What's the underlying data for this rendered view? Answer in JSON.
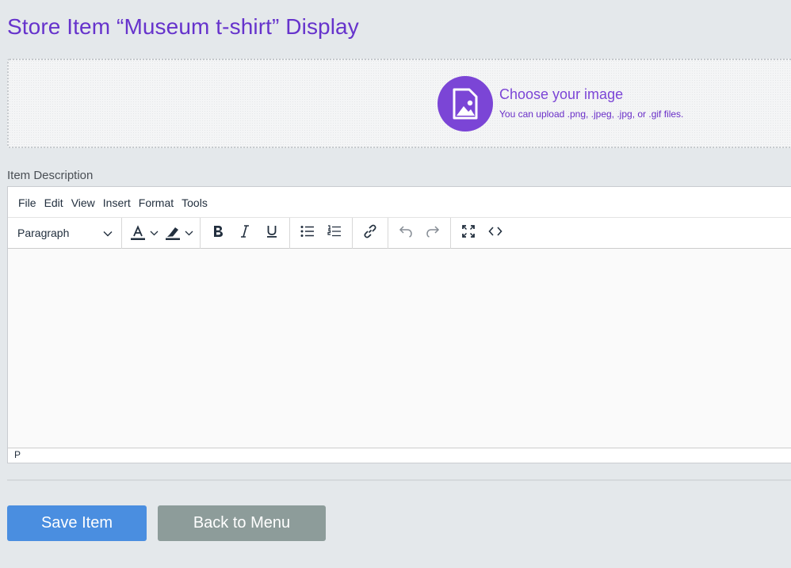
{
  "page": {
    "title": "Store Item “Museum t-shirt” Display"
  },
  "upload": {
    "title": "Choose your image",
    "hint": "You can upload .png, .jpeg, .jpg, or .gif files.",
    "icon": "image-file-icon",
    "accent_color": "#7b45d6"
  },
  "description": {
    "label": "Item Description"
  },
  "editor": {
    "menu": [
      "File",
      "Edit",
      "View",
      "Insert",
      "Format",
      "Tools"
    ],
    "block_format": "Paragraph",
    "toolbar_icons": [
      "text-color-icon",
      "highlight-color-icon",
      "bold-icon",
      "italic-icon",
      "underline-icon",
      "bullet-list-icon",
      "numbered-list-icon",
      "link-icon",
      "undo-icon",
      "redo-icon",
      "fullscreen-icon",
      "source-code-icon"
    ],
    "status_path": "P",
    "content": ""
  },
  "actions": {
    "save_label": "Save Item",
    "back_label": "Back to Menu",
    "save_color": "#4a8ee0",
    "back_color": "#8d9c9a"
  }
}
